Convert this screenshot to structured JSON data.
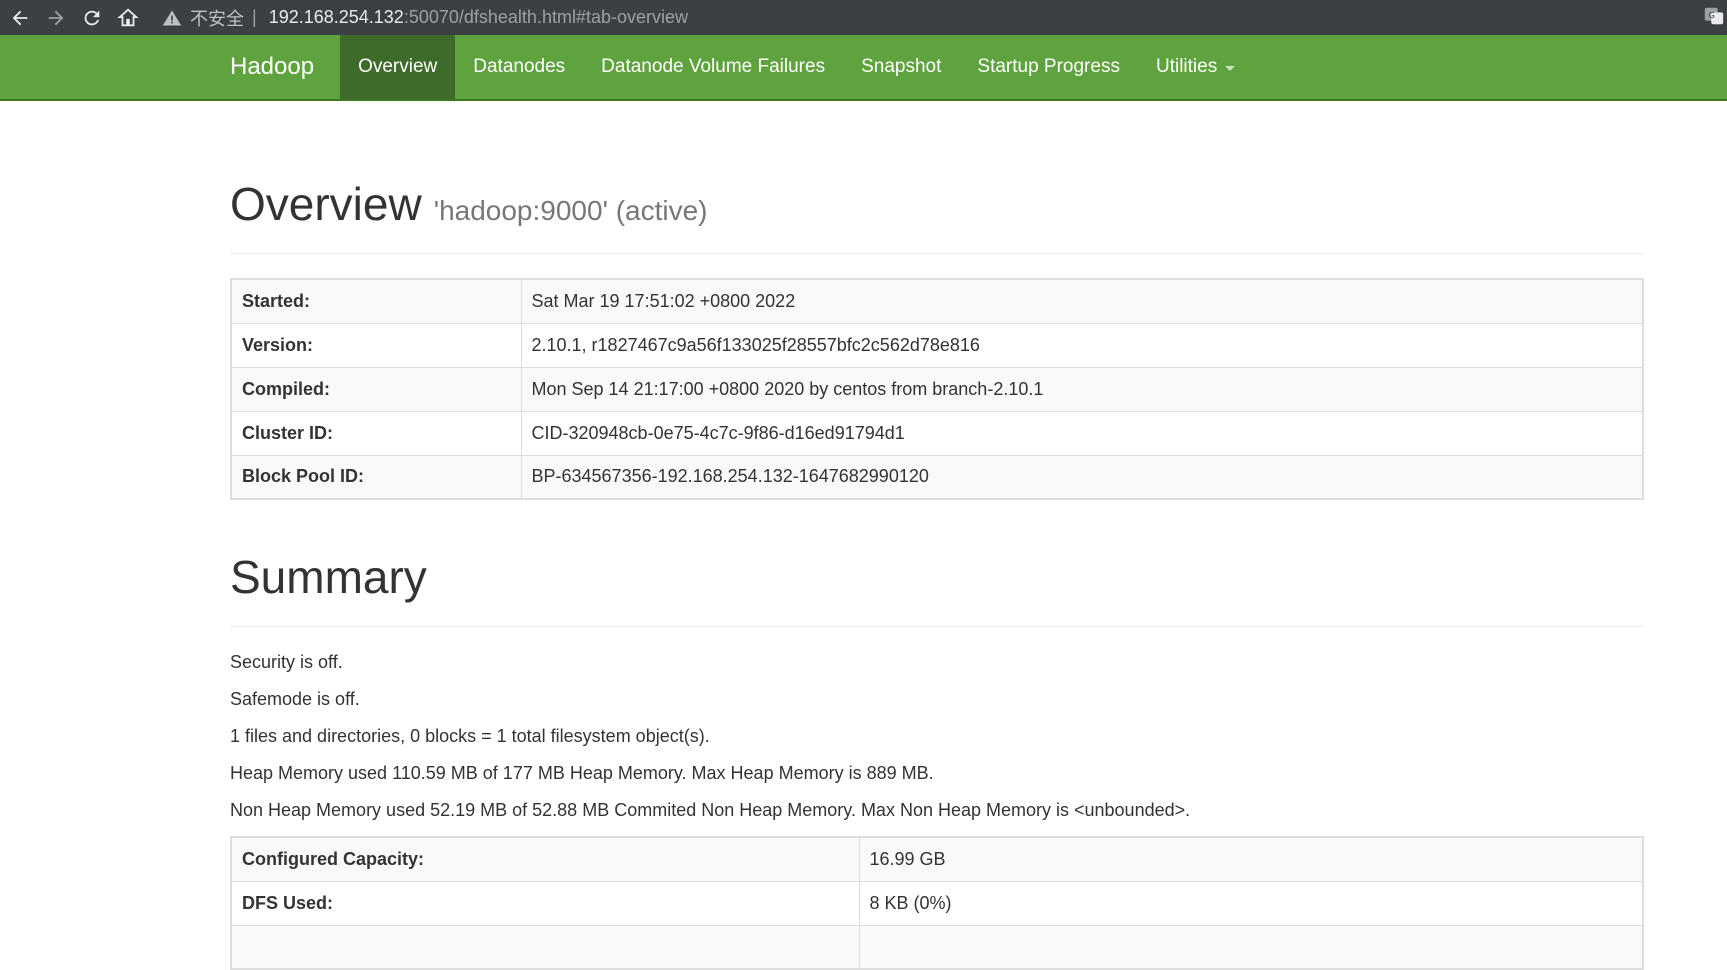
{
  "browser": {
    "insecure_label": "不安全",
    "url_host": "192.168.254.132",
    "url_rest": ":50070/dfshealth.html#tab-overview"
  },
  "navbar": {
    "brand": "Hadoop",
    "items": [
      {
        "label": "Overview",
        "active": true
      },
      {
        "label": "Datanodes"
      },
      {
        "label": "Datanode Volume Failures"
      },
      {
        "label": "Snapshot"
      },
      {
        "label": "Startup Progress"
      },
      {
        "label": "Utilities"
      }
    ]
  },
  "overview": {
    "title": "Overview",
    "subtitle": "'hadoop:9000' (active)",
    "rows": [
      {
        "label": "Started:",
        "value": "Sat Mar 19 17:51:02 +0800 2022"
      },
      {
        "label": "Version:",
        "value": "2.10.1, r1827467c9a56f133025f28557bfc2c562d78e816"
      },
      {
        "label": "Compiled:",
        "value": "Mon Sep 14 21:17:00 +0800 2020 by centos from branch-2.10.1"
      },
      {
        "label": "Cluster ID:",
        "value": "CID-320948cb-0e75-4c7c-9f86-d16ed91794d1"
      },
      {
        "label": "Block Pool ID:",
        "value": "BP-634567356-192.168.254.132-1647682990120"
      }
    ]
  },
  "summary": {
    "title": "Summary",
    "lines": [
      "Security is off.",
      "Safemode is off.",
      "1 files and directories, 0 blocks = 1 total filesystem object(s).",
      "Heap Memory used 110.59 MB of 177 MB Heap Memory. Max Heap Memory is 889 MB.",
      "Non Heap Memory used 52.19 MB of 52.88 MB Commited Non Heap Memory. Max Non Heap Memory is <unbounded>."
    ],
    "capacity_rows": [
      {
        "label": "Configured Capacity:",
        "value": "16.99 GB"
      },
      {
        "label": "DFS Used:",
        "value": "8 KB (0%)"
      }
    ]
  }
}
